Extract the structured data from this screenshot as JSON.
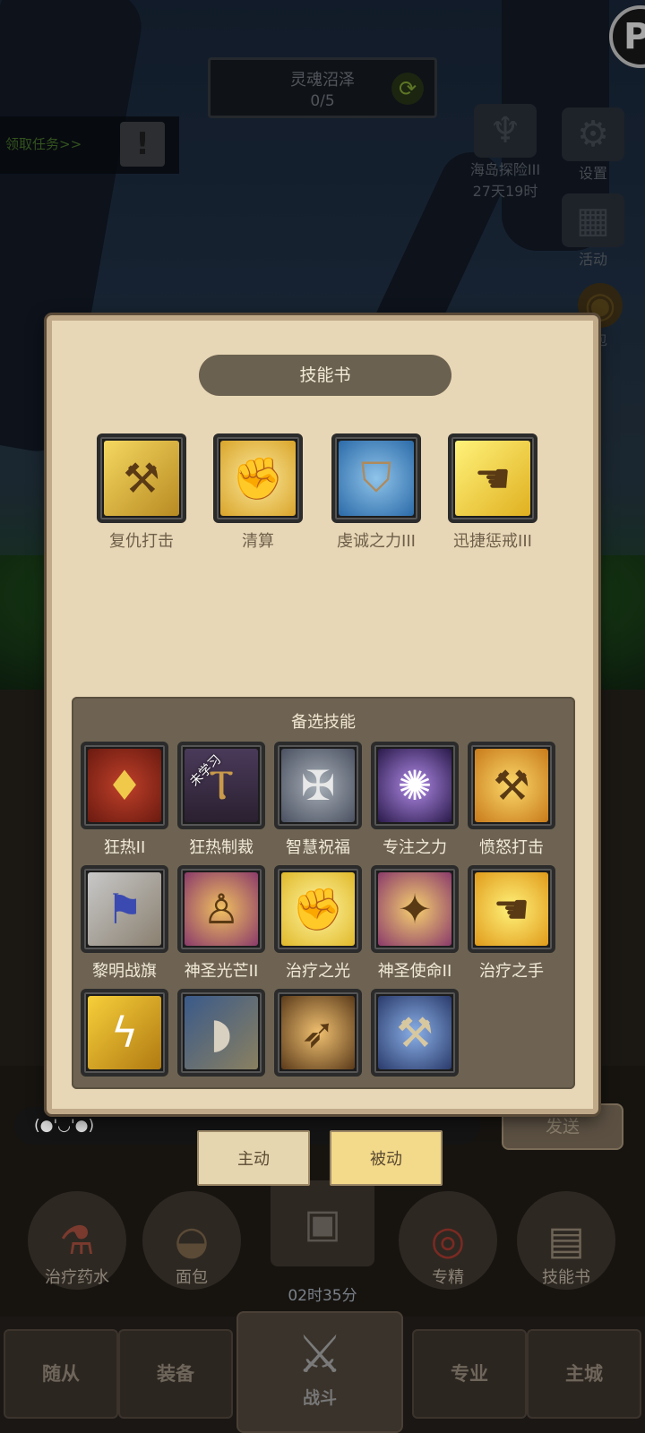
{
  "hud": {
    "zone_name": "灵魂沼泽",
    "zone_progress": "0/5",
    "quest_label": "领取任务>>",
    "quest_alert": "!",
    "event_name": "海岛探险III",
    "event_time": "27天19时",
    "settings_label": "设置",
    "activity_label": "活动",
    "bag_label_partial": "包"
  },
  "panel": {
    "title": "技能书",
    "equipped": [
      {
        "label": "复仇打击",
        "icon": "hammer-icon"
      },
      {
        "label": "清算",
        "icon": "fist-icon"
      },
      {
        "label": "虔诚之力III",
        "icon": "shield-icon"
      },
      {
        "label": "迅捷惩戒III",
        "icon": "hand-icon"
      }
    ],
    "alternates_title": "备选技能",
    "unlearned_tag": "未学习",
    "alternates": [
      {
        "label": "狂热II",
        "icon": "flame-drop-icon"
      },
      {
        "label": "狂热制裁",
        "icon": "pillar-icon"
      },
      {
        "label": "智慧祝福",
        "icon": "cross-icon"
      },
      {
        "label": "专注之力",
        "icon": "orb-icon"
      },
      {
        "label": "愤怒打击",
        "icon": "hammer-icon"
      },
      {
        "label": "黎明战旗",
        "icon": "banner-icon"
      },
      {
        "label": "神圣光芒II",
        "icon": "figure-icon"
      },
      {
        "label": "治疗之光",
        "icon": "fist-icon"
      },
      {
        "label": "神圣使命II",
        "icon": "wings-icon"
      },
      {
        "label": "治疗之手",
        "icon": "hand-icon"
      },
      {
        "label": "",
        "icon": "flame-icon"
      },
      {
        "label": "",
        "icon": "shield-icon"
      },
      {
        "label": "",
        "icon": "crossbow-icon"
      },
      {
        "label": "",
        "icon": "hammer-icon"
      }
    ]
  },
  "tabs": {
    "active": "主动",
    "passive": "被动"
  },
  "chat": {
    "input_value": "(●'◡'●)",
    "send": "发送"
  },
  "actions": {
    "potion": "治疗药水",
    "bread": "面包",
    "chest_timer": "02时35分",
    "specialty": "专精",
    "skillbook": "技能书"
  },
  "nav": {
    "followers": "随从",
    "equipment": "装备",
    "battle": "战斗",
    "profession": "专业",
    "city": "主城"
  },
  "colors": {
    "panel_bg": "#e8d7b6",
    "alt_bg": "#6e6352",
    "tab_selected": "#f3d98a"
  }
}
